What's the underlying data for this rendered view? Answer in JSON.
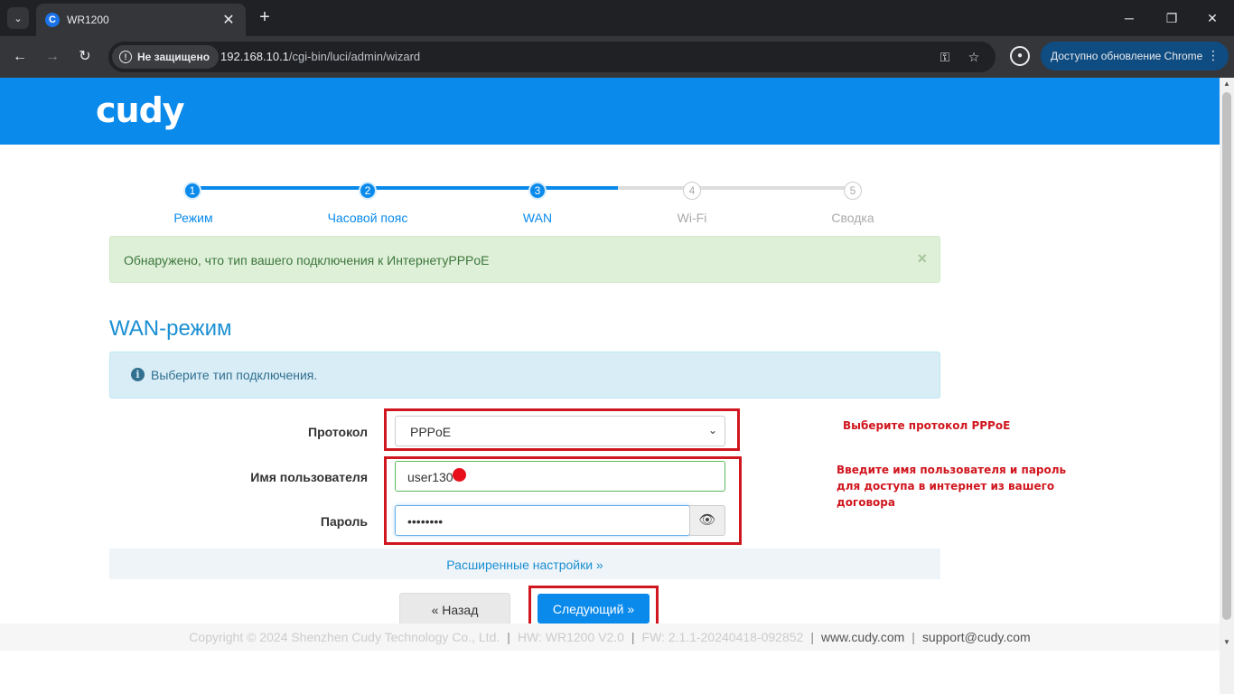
{
  "browser": {
    "tab_title": "WR1200",
    "favicon_letter": "C",
    "security_label": "Не защищено",
    "url_host": "192.168.10.1",
    "url_path": "/cgi-bin/luci/admin/wizard",
    "update_label": "Доступно обновление Chrome"
  },
  "header": {
    "logo": "cudy"
  },
  "steps": [
    {
      "num": "1",
      "label": "Режим",
      "state": "done"
    },
    {
      "num": "2",
      "label": "Часовой пояс",
      "state": "done"
    },
    {
      "num": "3",
      "label": "WAN",
      "state": "done"
    },
    {
      "num": "4",
      "label": "Wi-Fi",
      "state": "todo"
    },
    {
      "num": "5",
      "label": "Сводка",
      "state": "todo"
    }
  ],
  "alert_success": {
    "text": "Обнаружено, что тип вашего подключения к ИнтернетуPPPoE",
    "close": "×"
  },
  "section_title": "WAN-режим",
  "alert_info": {
    "icon": "i",
    "text": "Выберите тип подключения."
  },
  "form": {
    "protocol_label": "Протокол",
    "protocol_value": "PPPoE",
    "username_label": "Имя пользователя",
    "username_value": "user130",
    "password_label": "Пароль",
    "password_value": "••••••••"
  },
  "annotations": {
    "protocol_note": "Выберите протокол PPPoE",
    "credentials_note_1": "Введите имя пользователя и пароль",
    "credentials_note_2": "для доступа в интернет из вашего",
    "credentials_note_3": "договора"
  },
  "advanced_label": "Расширенные настройки »",
  "buttons": {
    "back": "« Назад",
    "next": "Следующий »"
  },
  "footer": {
    "copyright": "Copyright © 2024 Shenzhen Cudy Technology Co., Ltd.",
    "hw": "HW: WR1200 V2.0",
    "fw": "FW: 2.1.1-20240418-092852",
    "site": "www.cudy.com",
    "email": "support@cudy.com",
    "sep": "|"
  },
  "colors": {
    "brand": "#0a8aeb",
    "highlight": "#d0161e",
    "success_bg": "#dff0d8",
    "info_bg": "#d9edf7"
  }
}
